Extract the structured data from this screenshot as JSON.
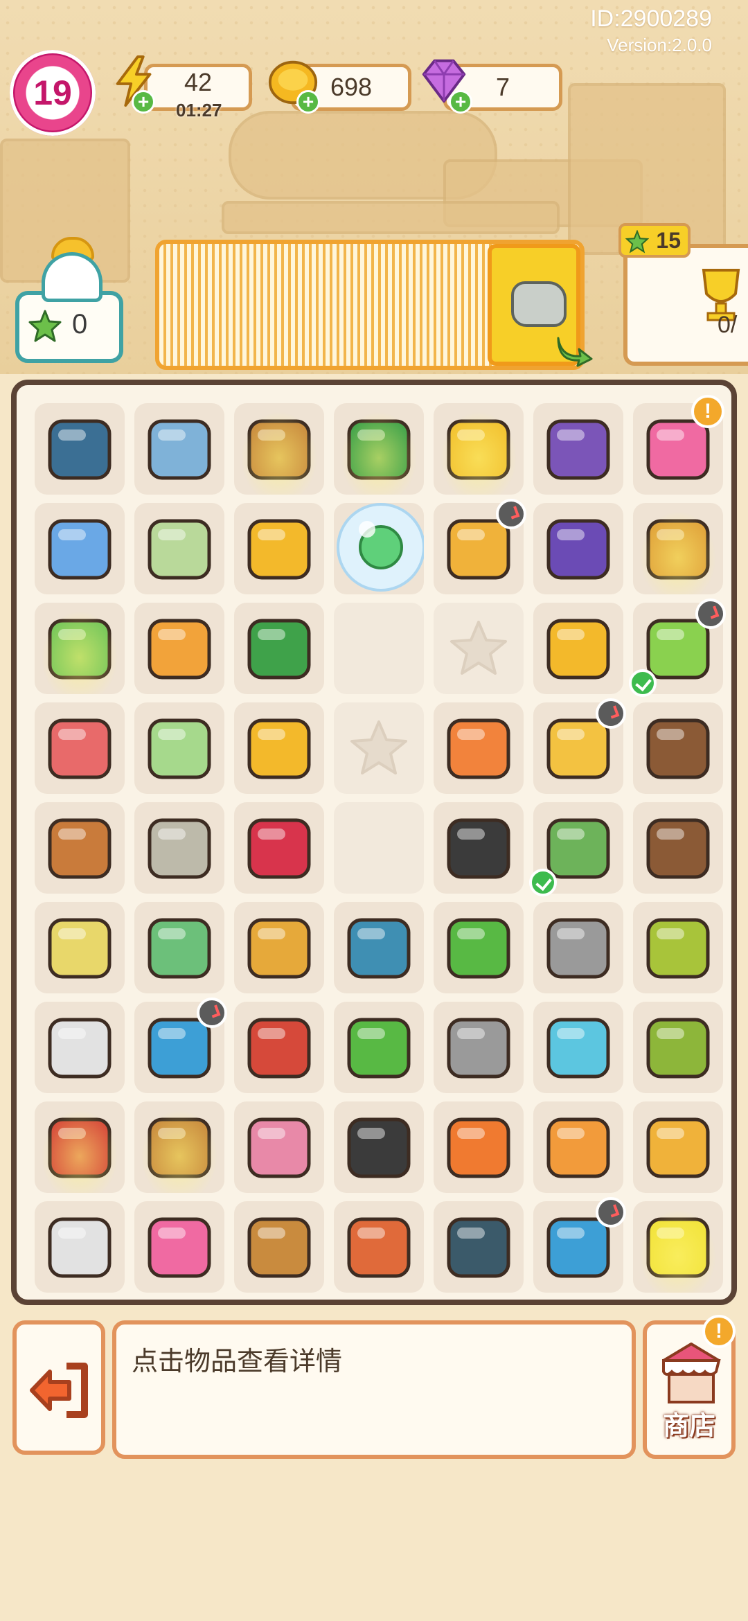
{
  "header": {
    "id_text": "ID:2900289",
    "version_text": "Version:2.0.0",
    "level": "19",
    "energy": "42",
    "energy_timer": "01:27",
    "coins": "698",
    "gems": "7"
  },
  "order_area": {
    "star_count": "0",
    "trophy_tag": "15",
    "trophy_progress": "0/"
  },
  "board": {
    "cells": [
      "chip-web",
      "clipboard",
      "basket-spark",
      "cash-register-spark",
      "cart-spark",
      "bin-tire",
      "pink-backpack-alert",
      "chart-paper",
      "flyer",
      "medal",
      "bubble-8",
      "drawer-clock",
      "phone",
      "potted-soil-spark",
      "laptop-spark",
      "tape-roll",
      "cash-stack",
      "empty",
      "empty-star",
      "coins",
      "tree-clock-check",
      "toolbox",
      "poster",
      "rosette",
      "empty-star",
      "apple-core",
      "cardboard-box-clock",
      "plant-pot",
      "glove",
      "rubble",
      "ribbon-medal",
      "empty",
      "pipe-wrench",
      "gloves-check",
      "sprout-pot",
      "frame",
      "bills",
      "key-tag",
      "tiles",
      "pliers",
      "wrench",
      "seed-bag",
      "roller",
      "robot-vacuum-clock",
      "keys",
      "saw",
      "wrench-silver",
      "hose",
      "soil-bag",
      "bucket-spark",
      "basket-tools-spark",
      "bricks",
      "pipe",
      "cooler",
      "pencil",
      "box-open",
      "roller",
      "pink-bricks",
      "wicker-basket",
      "cutter",
      "disc-pads",
      "robot-vacuum2-clock",
      "cart2-spark"
    ]
  },
  "detail": {
    "hint": "点击物品查看详情"
  },
  "shop": {
    "label": "商店"
  },
  "colors": {
    "frame_brown": "#5b4335",
    "accent_orange": "#e2935c",
    "level_pink": "#c4166a",
    "energy_yellow": "#f7cf28",
    "check_green": "#3dbb4e"
  }
}
